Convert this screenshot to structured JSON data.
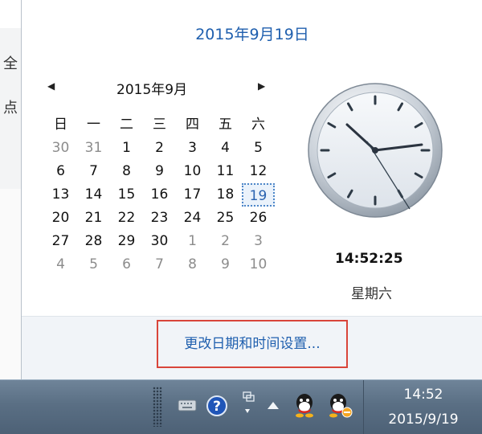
{
  "background_window": {
    "chars": [
      "全",
      "点"
    ]
  },
  "flyout": {
    "date_title": "2015年9月19日",
    "month_title": "2015年9月",
    "prev_icon": "triangle-left-icon",
    "next_icon": "triangle-right-icon",
    "weekdays": [
      "日",
      "一",
      "二",
      "三",
      "四",
      "五",
      "六"
    ],
    "weeks": [
      [
        "30",
        "31",
        "1",
        "2",
        "3",
        "4",
        "5"
      ],
      [
        "6",
        "7",
        "8",
        "9",
        "10",
        "11",
        "12"
      ],
      [
        "13",
        "14",
        "15",
        "16",
        "17",
        "18",
        "19"
      ],
      [
        "20",
        "21",
        "22",
        "23",
        "24",
        "25",
        "26"
      ],
      [
        "27",
        "28",
        "29",
        "30",
        "1",
        "2",
        "3"
      ],
      [
        "4",
        "5",
        "6",
        "7",
        "8",
        "9",
        "10"
      ]
    ],
    "selected_day": "19",
    "time": "14:52:25",
    "weekday": "星期六",
    "link": "更改日期和时间设置..."
  },
  "taskbar": {
    "icons": [
      "keyboard-icon",
      "help-icon",
      "network-icon",
      "show-hidden-icons-icon",
      "qq-icon",
      "qq-alert-icon"
    ],
    "time": "14:52",
    "date": "2015/9/19"
  },
  "colors": {
    "link_blue": "#1f5fae",
    "highlight_border": "#d9453a",
    "taskbar": "#5a6f84"
  }
}
